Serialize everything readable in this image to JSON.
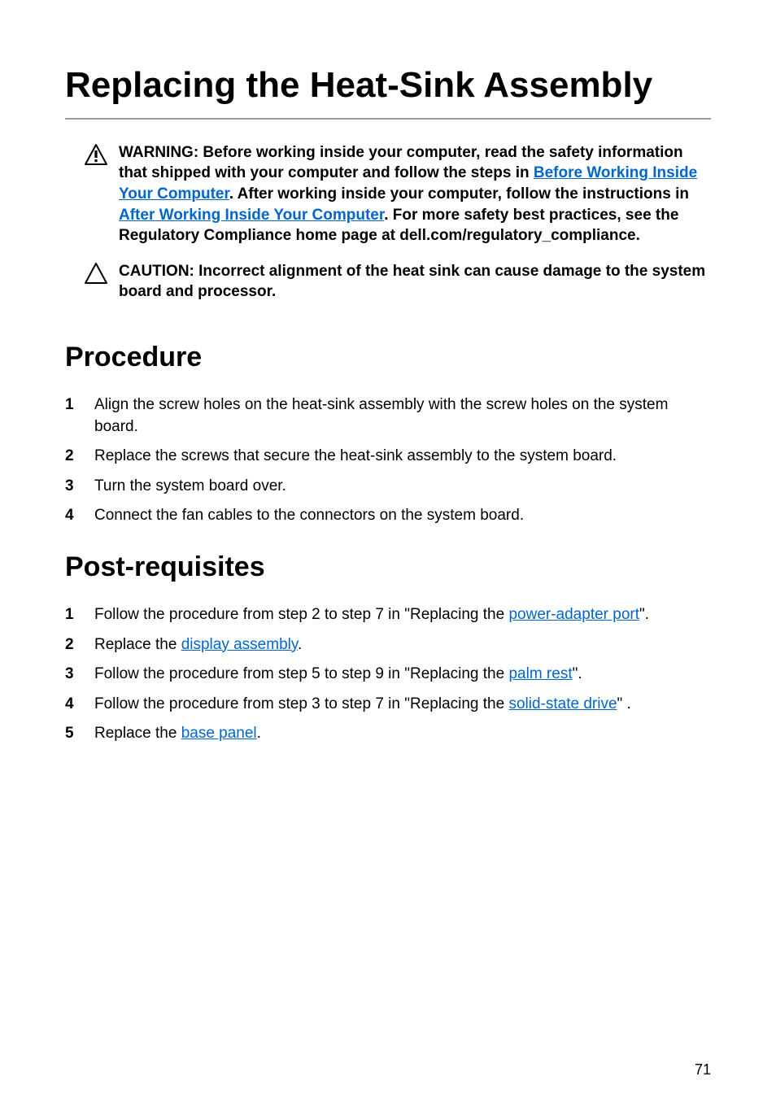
{
  "title": "Replacing the Heat-Sink Assembly",
  "warning": {
    "prefix": "WARNING: Before working inside your computer, read the safety information that shipped with your computer and follow the steps in ",
    "link1_text": "Before Working Inside Your Computer",
    "middle1": ". After working inside your computer, follow the instructions in ",
    "link2_text": "After Working Inside Your Computer",
    "suffix": ". For more safety best practices, see the Regulatory Compliance home page at dell.com/regulatory_compliance."
  },
  "caution": "CAUTION: Incorrect alignment of the heat sink can cause damage to the system board and processor.",
  "procedure": {
    "heading": "Procedure",
    "items": [
      "Align the screw holes on the heat-sink assembly with the screw holes on the system board.",
      "Replace the screws that secure the heat-sink assembly to the system board.",
      "Turn the system board over.",
      "Connect the fan cables to the connectors on the system board."
    ]
  },
  "postreq": {
    "heading": "Post-requisites",
    "items": [
      {
        "prefix": "Follow the procedure from step 2 to step 7 in \"Replacing the ",
        "link": "power-adapter port",
        "suffix": "\"."
      },
      {
        "prefix": "Replace the ",
        "link": "display assembly",
        "suffix": "."
      },
      {
        "prefix": "Follow the procedure from step 5 to step 9 in \"Replacing the ",
        "link": "palm rest",
        "suffix": "\"."
      },
      {
        "prefix": "Follow the procedure from step 3 to step 7 in \"Replacing the ",
        "link": "solid-state drive",
        "suffix": "\" ."
      },
      {
        "prefix": "Replace the ",
        "link": "base panel",
        "suffix": "."
      }
    ]
  },
  "page_number": "71"
}
